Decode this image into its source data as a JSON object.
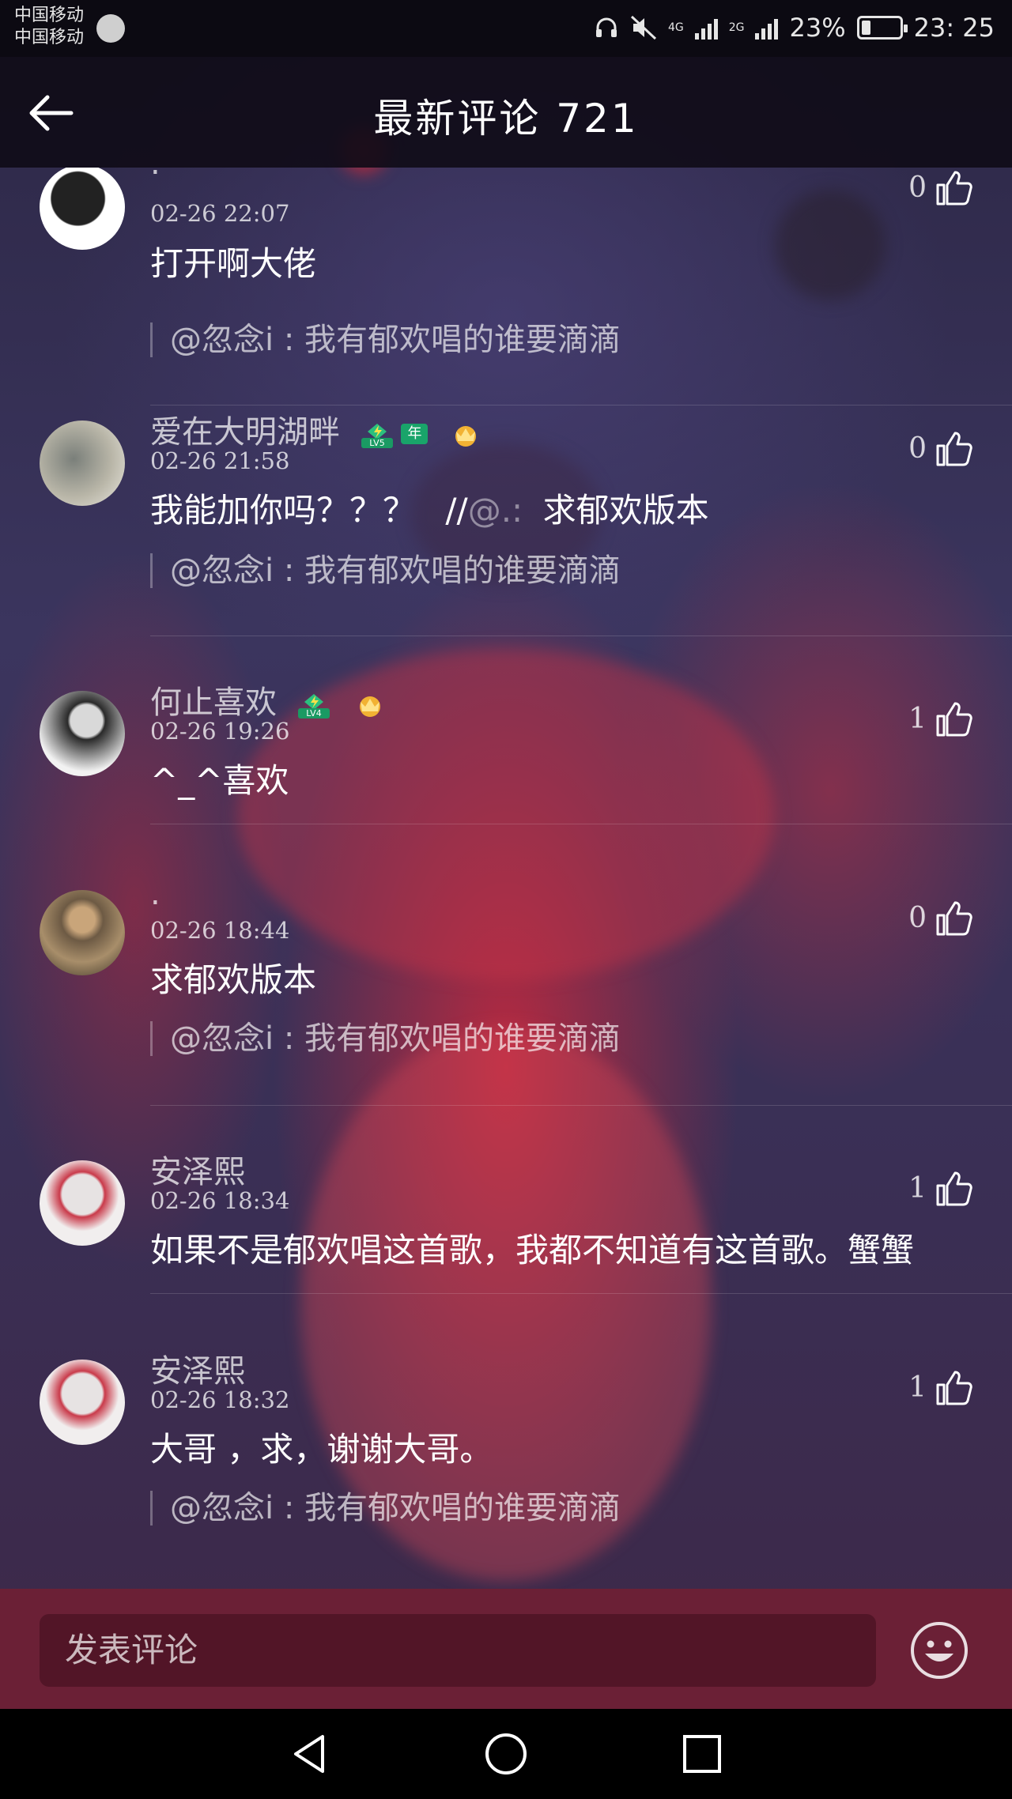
{
  "status_bar": {
    "carrier_1": "中国移动",
    "carrier_2": "中国移动",
    "network_1": "4G",
    "network_2": "2G",
    "battery": "23%",
    "battery_level": 0.23,
    "time": "23: 25"
  },
  "header": {
    "title": "最新评论 721"
  },
  "comments": [
    {
      "name": ".",
      "time": "02-26 22:07",
      "likes": "0",
      "text": "打开啊大佬",
      "quote": "@忽念i : 我有郁欢唱的谁要滴滴"
    },
    {
      "name": "爱在大明湖畔",
      "badges": [
        "LV5",
        "年",
        "vip"
      ],
      "time": "02-26 21:58",
      "likes": "0",
      "text_main": "我能加你吗？？？",
      "text_sep": "//",
      "text_mention": "@.:",
      "text_tail": "求郁欢版本",
      "quote": "@忽念i : 我有郁欢唱的谁要滴滴"
    },
    {
      "name": "何止喜欢",
      "badges": [
        "LV4",
        "vip"
      ],
      "time": "02-26 19:26",
      "likes": "1",
      "text": "^_^喜欢"
    },
    {
      "name": ".",
      "time": "02-26 18:44",
      "likes": "0",
      "text": "求郁欢版本",
      "quote": "@忽念i : 我有郁欢唱的谁要滴滴"
    },
    {
      "name": "安泽熙",
      "time": "02-26 18:34",
      "likes": "1",
      "text": "如果不是郁欢唱这首歌，我都不知道有这首歌。蟹蟹"
    },
    {
      "name": "安泽熙",
      "time": "02-26 18:32",
      "likes": "1",
      "text": "大哥 ，求，谢谢大哥。",
      "quote": "@忽念i : 我有郁欢唱的谁要滴滴"
    }
  ],
  "composer": {
    "placeholder": "发表评论"
  },
  "icons": {
    "back": "back-arrow-icon",
    "like": "thumbs-up-icon",
    "emoji": "smiley-icon",
    "nav_back": "triangle-back-icon",
    "nav_home": "circle-home-icon",
    "nav_recent": "square-recent-icon"
  },
  "colors": {
    "composer_bg": "#6b2036",
    "year_badge": "#19a46a"
  }
}
